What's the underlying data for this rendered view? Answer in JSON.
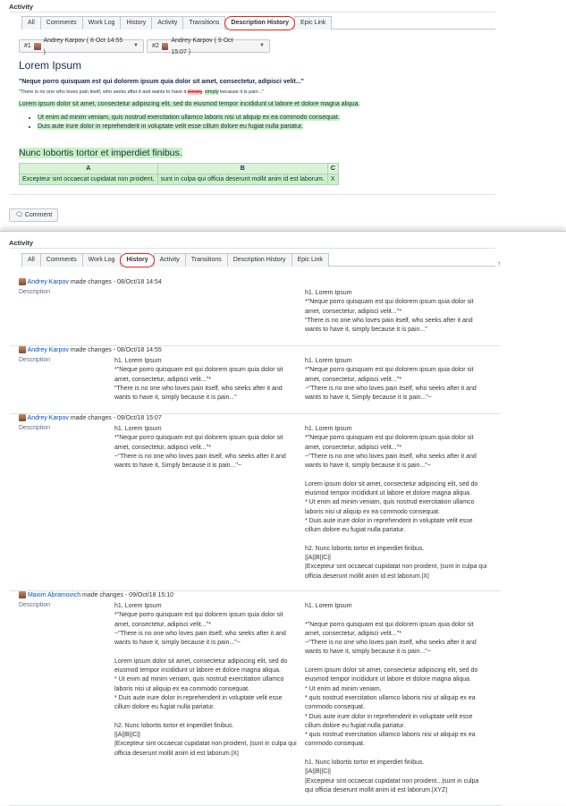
{
  "top": {
    "activity": "Activity",
    "tabs": [
      "All",
      "Comments",
      "Work Log",
      "History",
      "Activity",
      "Transitions",
      "Description History",
      "Epic Link"
    ],
    "active_tab": "Description History",
    "select1": {
      "num": "#1",
      "label": "Andrey Karpov ( 8 Oct 14:55 )"
    },
    "select2": {
      "num": "#2",
      "label": "Andrey Karpov ( 9 Oct 15:07 )"
    },
    "title": "Lorem Ipsum",
    "bold_quote": "\"Neque porro quisquam est qui dolorem ipsum quia dolor sit amet, consectetur, adipisci velit...\"",
    "small_quote_pre": "\"There is no one who loves pain itself, who seeks after it and wants to have it.",
    "small_quote_del": "Simply",
    "small_quote_ins": "simply",
    "small_quote_post": " because it is pain...\"",
    "green_para": "Lorem ipsum dolor sit amet, consectetur adipiscing elit, sed do eiusmod tempor incididunt ut labore et dolore magna aliqua.",
    "bullets": [
      "Ut enim ad minim veniam, quis nostrud exercitation ullamco laboris nisi ut aliquip ex ea commodo consequat.",
      "Duis aute irure dolor in reprehenderit in voluptate velit esse cillum dolore eu fugiat nulla pariatur."
    ],
    "h2": "Nunc lobortis tortor et imperdiet finibus.",
    "table": {
      "headers": [
        "A",
        "B",
        "C"
      ],
      "row": [
        "Excepteur sint occaecat cupidatat non proident,",
        "sunt in culpa qui officia deserunt mollit anim id est laborum.",
        "X"
      ]
    },
    "comment": "Comment"
  },
  "bottom": {
    "activity": "Activity",
    "tabs": [
      "All",
      "Comments",
      "Work Log",
      "History",
      "Activity",
      "Transitions",
      "Description History",
      "Epic Link"
    ],
    "active_tab": "History",
    "entries": [
      {
        "user": "Andrey Karpov",
        "action": " made changes - 08/Oct/18 14:54",
        "field": "Description",
        "old": "",
        "new": "h1. Lorem Ipsum\n*\"Neque porro quisquam est qui dolorem ipsum quia dolor sit\namet, consectetur, adipisci velit...\"*\n\"There is no one who loves pain itself, who seeks after it and\nwants to have it, simply because it is pain...\""
      },
      {
        "user": "Andrey Karpov",
        "action": " made changes - 08/Oct/18 14:55",
        "field": "Description",
        "old": "h1. Lorem Ipsum\n*\"Neque porro quisquam est qui dolorem ipsum quia dolor sit\namet, consectetur, adipisci velit...\"*\n\"There is no one who loves pain itself, who seeks after it and\nwants to have it, simply because it is pain...\"",
        "new": "h1. Lorem Ipsum\n*\"Neque porro quisquam est qui dolorem ipsum quia dolor sit\namet, consectetur, adipisci velit...\"*\n~\"There is no one who loves pain itself, who seeks after it and\nwants to have it, Simply because it is pain...\"~"
      },
      {
        "user": "Andrey Karpov",
        "action": " made changes - 09/Oct/18 15:07",
        "field": "Description",
        "old": "h1. Lorem Ipsum\n*\"Neque porro quisquam est qui dolorem ipsum quia dolor sit\namet, consectetur, adipisci velit...\"*\n~\"There is no one who loves pain itself, who seeks after it and\nwants to have it, Simply because it is pain...\"~",
        "new": "h1. Lorem Ipsum\n*\"Neque porro quisquam est qui dolorem ipsum quia dolor sit\namet, consectetur, adipisci velit...\"*\n~\"There is no one who loves pain itself, who seeks after it and\nwants to have it, simply because it is pain...\"~\n\nLorem ipsum dolor sit amet, consectetur adipiscing elit, sed do\neiusmod tempor incididunt ut labore et dolore magna aliqua.\n* Ut enim ad minim veniam, quis nostrud exercitation ullamco\nlaboris nisi ut aliquip ex ea commodo consequat.\n* Duis aute irure dolor in reprehenderit in voluptate velit esse\ncillum dolore eu fugiat nulla pariatur.\n\nh2. Nunc lobortis tortor et imperdiet finibus.\n||A||B||C||\n|Excepteur sint occaecat cupidatat non proident, |sunt in culpa qui\nofficia deserunt mollit anim id est laborum.|X|"
      },
      {
        "user": "Maxim Abramovich",
        "action": " made changes - 09/Oct/18 15:10",
        "field": "Description",
        "old": "h1. Lorem Ipsum\n*\"Neque porro quisquam est qui dolorem ipsum quia dolor sit\namet, consectetur, adipisci velit...\"*\n~\"There is no one who loves pain itself, who seeks after it and\nwants to have it, simply because it is pain...\"~\n\nLorem ipsum dolor sit amet, consectetur adipiscing elit, sed do\neiusmod tempor incididunt ut labore et dolore magna aliqua.\n* Ut enim ad minim veniam, quis nostrud exercitation ullamco\nlaboris nisi ut aliquip ex ea commodo consequat.\n* Duis aute irure dolor in reprehenderit in voluptate velit esse\ncillum dolore eu fugiat nulla pariatur.\n\nh2. Nunc lobortis tortor et imperdiet finibus.\n||A||B||C||\n|Excepteur sint occaecat cupidatat non proident, |sunt in culpa qui\nofficia deserunt mollit anim id est laborum.|X|",
        "new": "h1. Lorem Ipsum\n\n*\"Neque porro quisquam est qui dolorem ipsum quia dolor sit\namet, consectetur, adipisci velit...\"*\n~\"There is no one who loves pain itself, who seeks after it and\nwants to have it, simply because it is pain...\"~\n\nLorem ipsum dolor sit amet, consectetur adipiscing elit, sed do\neiusmod tempor incididunt ut labore et dolore magna aliqua.\n* Ut enim ad minim veniam,\n* quis nostrud exercitation ullamco laboris nisi ut aliquip ex ea\ncommodo consequat.\n* Duis aute irure dolor in reprehenderit in voluptate velit esse\ncillum dolore eu fugiat nulla pariatur.\n* quis nostrud exercitation ullamco laboris nisi ut aliquip ex ea\ncommodo consequat.\n\nh1. Nunc lobortis tortor et imperdiet finibus.\n||A||B||C||\n|Excepteur sint occaecat cupidatat non proident...|sunt in culpa\nqui officia deserunt mollit anim id est laborum.|XYZ|"
      }
    ]
  },
  "colors": {
    "added": "#c8f2c2",
    "removed": "#fbc7c5",
    "link": "#0052cc",
    "highlight_circle": "#e0261e"
  },
  "icons": {
    "avatar": "user-avatar-icon",
    "caret": "chevron-down-icon",
    "comment": "comment-icon",
    "scroll": "arrow-up-icon"
  }
}
